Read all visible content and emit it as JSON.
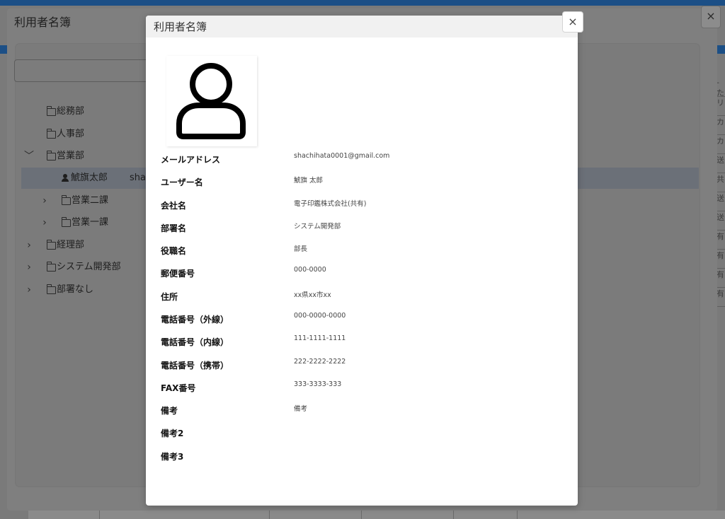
{
  "outer_dialog": {
    "title": "利用者名簿",
    "close_glyph": "×",
    "tree": [
      {
        "label": "総務部",
        "expanded": false,
        "has_chevron": false
      },
      {
        "label": "人事部",
        "expanded": false,
        "has_chevron": false
      },
      {
        "label": "営業部",
        "expanded": true,
        "has_chevron": true,
        "chevron": "﹀"
      },
      {
        "label": "鯱旗太郎",
        "trailing": "shac",
        "type": "user"
      },
      {
        "label": "営業二課",
        "chevron": "›"
      },
      {
        "label": "営業一課",
        "chevron": "›"
      },
      {
        "label": "経理部",
        "chevron": "›"
      },
      {
        "label": "システム開発部",
        "chevron": "›"
      },
      {
        "label": "部署なし",
        "chevron": "›"
      }
    ],
    "right_column_fragments": [
      "-た",
      "リ",
      "カ",
      "カ",
      "送",
      "共",
      "送",
      "送",
      "有",
      "有",
      "有",
      "有"
    ]
  },
  "modal": {
    "title": "利用者名簿",
    "close_glyph": "×",
    "avatar_icon": "user-outline-icon",
    "fields": [
      {
        "label": "メールアドレス",
        "value": "shachihata0001@gmail.com"
      },
      {
        "label": "ユーザー名",
        "value": "鯱旗 太郎"
      },
      {
        "label": "会社名",
        "value": "電子印鑑株式会社(共有)"
      },
      {
        "label": "部署名",
        "value": "システム開発部"
      },
      {
        "label": "役職名",
        "value": "部長"
      },
      {
        "label": "郵便番号",
        "value": "000-0000"
      },
      {
        "label": "住所",
        "value": "xx県xx市xx"
      },
      {
        "label": "電話番号（外線）",
        "value": "000-0000-0000"
      },
      {
        "label": "電話番号（内線）",
        "value": "111-1111-1111"
      },
      {
        "label": "電話番号（携帯）",
        "value": "222-2222-2222"
      },
      {
        "label": "FAX番号",
        "value": "333-3333-333"
      },
      {
        "label": "備考",
        "value": "備考"
      },
      {
        "label": "備考2",
        "value": ""
      },
      {
        "label": "備考3",
        "value": ""
      }
    ]
  },
  "colors": {
    "overlay_bg": "#7a7a7a",
    "brand_blue": "#1c4f86",
    "modal_header": "#f1f1f1",
    "modal_bg": "#ffffff"
  }
}
